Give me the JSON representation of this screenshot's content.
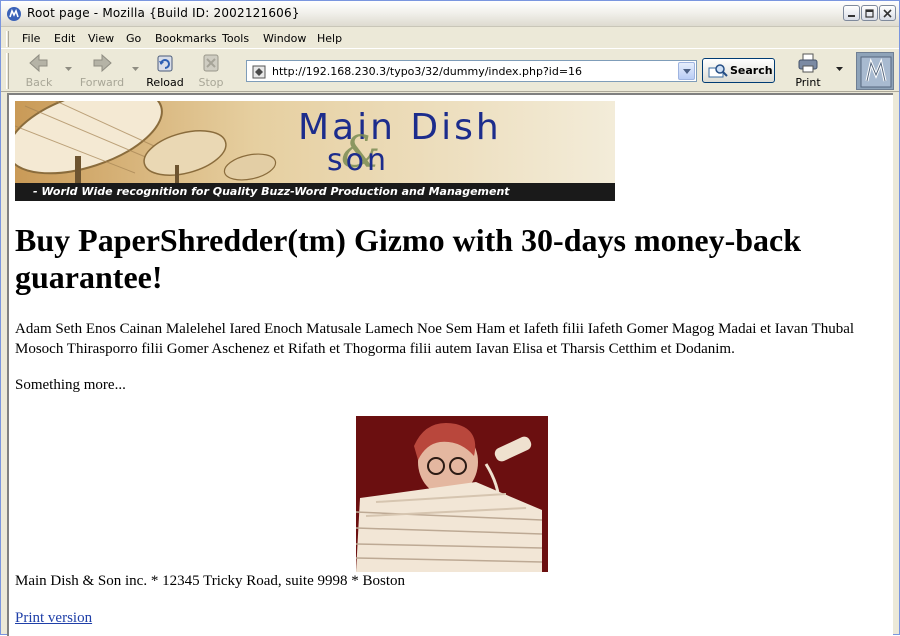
{
  "window": {
    "title": "Root page - Mozilla {Build ID: 2002121606}"
  },
  "menu": [
    "File",
    "Edit",
    "View",
    "Go",
    "Bookmarks",
    "Tools",
    "Window",
    "Help"
  ],
  "toolbar": {
    "back_label": "Back",
    "forward_label": "Forward",
    "reload_label": "Reload",
    "stop_label": "Stop",
    "url": "http://192.168.230.3/typo3/32/dummy/index.php?id=16",
    "search_label": "Search",
    "print_label": "Print"
  },
  "page": {
    "banner_title": "Main Dish",
    "banner_amp": "&",
    "banner_sub": "son",
    "banner_tagline": "- World Wide recognition for Quality Buzz-Word Production and Management",
    "heading": "Buy PaperShredder(tm) Gizmo with 30-days money-back guarantee!",
    "paragraph1": "Adam Seth Enos Cainan Malelehel Iared Enoch Matusale Lamech Noe Sem Ham et Iafeth filii Iafeth Gomer Magog Madai et Iavan Thubal Mosoch Thirasporro filii Gomer Aschenez et Rifath et Thogorma filii autem Iavan Elisa et Tharsis Cetthim et Dodanim.",
    "paragraph2": "Something more...",
    "footer": "Main Dish & Son inc. * 12345 Tricky Road, suite 9998 * Boston",
    "print_link": "Print version"
  },
  "colors": {
    "banner_text": "#1c2c8c",
    "link": "#1f3fa8",
    "photo_bg": "#6e0f0f"
  }
}
